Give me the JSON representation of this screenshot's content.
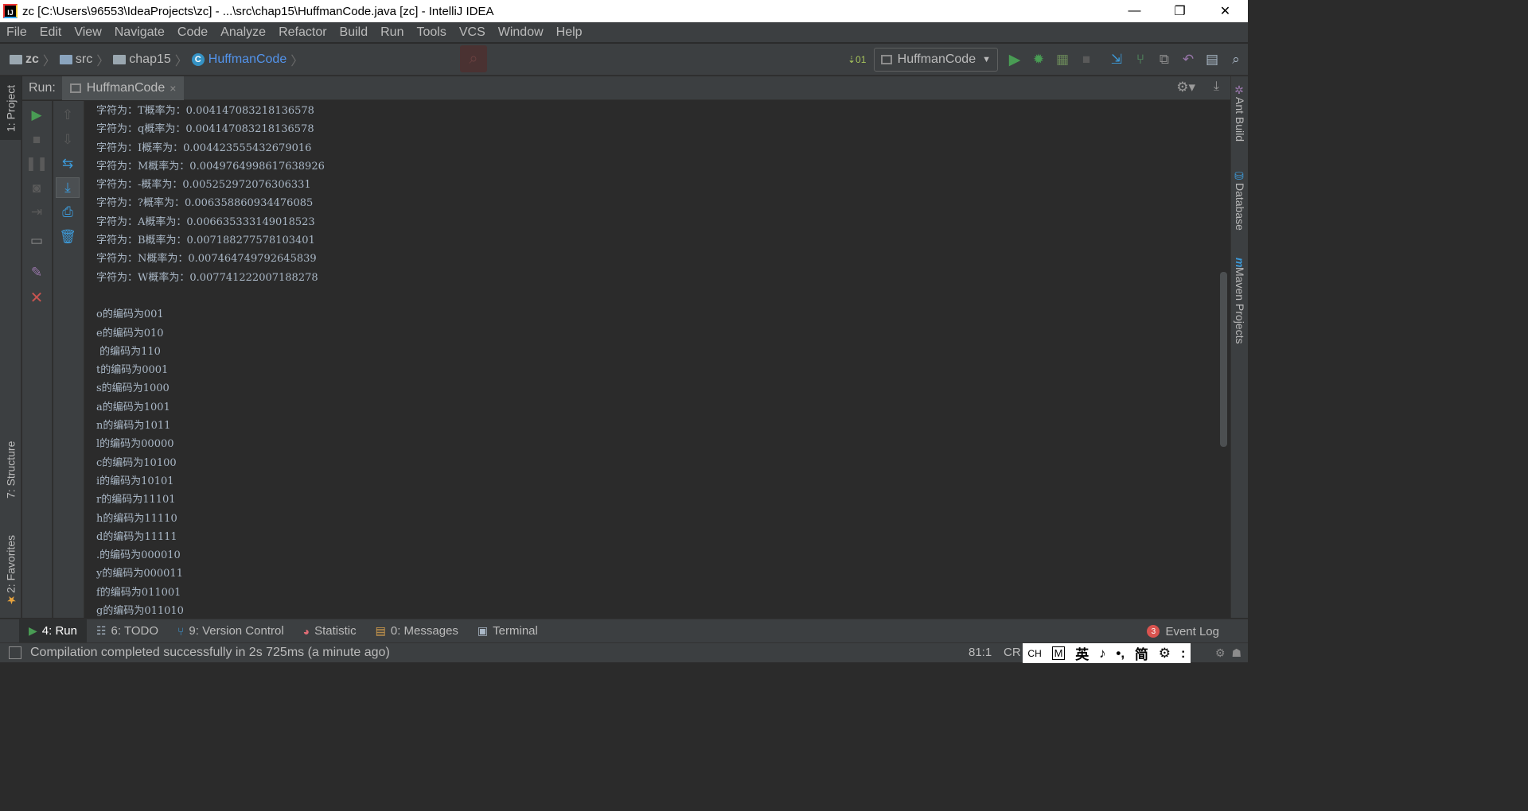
{
  "window": {
    "title": "zc [C:\\Users\\96553\\IdeaProjects\\zc] - ...\\src\\chap15\\HuffmanCode.java [zc] - IntelliJ IDEA",
    "app_icon_text": "IJ",
    "minimize": "—",
    "restore": "❐",
    "close": "✕"
  },
  "menu": [
    "File",
    "Edit",
    "View",
    "Navigate",
    "Code",
    "Analyze",
    "Refactor",
    "Build",
    "Run",
    "Tools",
    "VCS",
    "Window",
    "Help"
  ],
  "breadcrumb": [
    "zc",
    "src",
    "chap15",
    "HuffmanCode"
  ],
  "run_config": {
    "label": "HuffmanCode"
  },
  "run_panel": {
    "label": "Run:",
    "tab_label": "HuffmanCode",
    "tab_close": "×"
  },
  "console": {
    "lines": [
      "字符为：T概率为：0.004147083218136578",
      "字符为：q概率为：0.004147083218136578",
      "字符为：I概率为：0.004423555432679016",
      "字符为：M概率为：0.0049764998617638926",
      "字符为：-概率为：0.005252972076306331",
      "字符为：?概率为：0.006358860934476085",
      "字符为：A概率为：0.006635333149018523",
      "字符为：B概率为：0.007188277578103401",
      "字符为：N概率为：0.007464749792645839",
      "字符为：W概率为：0.007741222007188278",
      "",
      "o的编码为001",
      "e的编码为010",
      " 的编码为110",
      "t的编码为0001",
      "s的编码为1000",
      "a的编码为1001",
      "n的编码为1011",
      "l的编码为00000",
      "c的编码为10100",
      "i的编码为10101",
      "r的编码为11101",
      "h的编码为11110",
      "d的编码为11111",
      ".的编码为000010",
      "y的编码为000011",
      "f的编码为011001",
      "g的编码为011010"
    ]
  },
  "left_tabs": {
    "project": "1: Project",
    "structure": "7: Structure",
    "favorites": "2: Favorites"
  },
  "right_tabs": {
    "ant": "Ant Build",
    "database": "Database",
    "maven": "Maven Projects"
  },
  "bottom_tabs": [
    {
      "label": "4: Run",
      "icon": "run-icon"
    },
    {
      "label": "6: TODO",
      "icon": "todo-icon"
    },
    {
      "label": "9: Version Control",
      "icon": "vcs-icon"
    },
    {
      "label": "Statistic",
      "icon": "statistic-icon"
    },
    {
      "label": "0: Messages",
      "icon": "messages-icon"
    },
    {
      "label": "Terminal",
      "icon": "terminal-icon"
    }
  ],
  "event_log": {
    "label": "Event Log",
    "count": "3"
  },
  "status": {
    "message": "Compilation completed successfully in 2s 725ms (a minute ago)",
    "caret": "81:1",
    "line_separator": "CR",
    "ime_items": [
      "CH",
      "M",
      "英",
      "♪",
      "•,",
      "简",
      "⚙",
      ":"
    ]
  },
  "colors": {
    "run_green": "#499c54",
    "stop_red": "#c75450",
    "link_blue": "#5394ec",
    "console_text": "#a9b7c6"
  }
}
